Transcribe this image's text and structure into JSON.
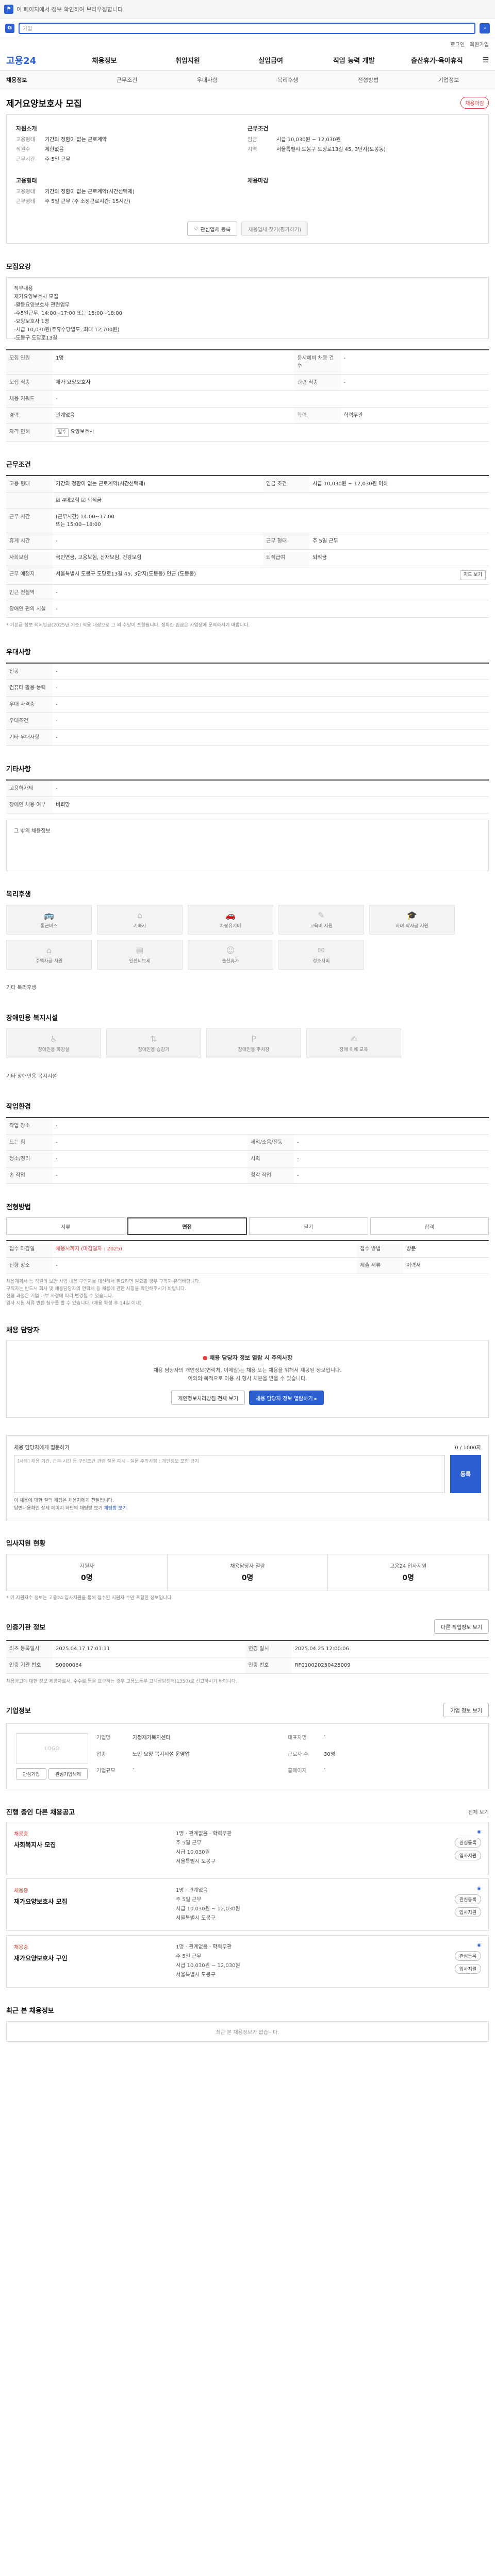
{
  "browser": {
    "top_text": "이 페이지에서 정보 확인하여 브라우징합니다"
  },
  "search": {
    "logo": "G",
    "placeholder": "가입"
  },
  "util": [
    "로그인",
    "회원가입"
  ],
  "gnb": {
    "logo": "고용24",
    "items": [
      "채용정보",
      "취업지원",
      "실업급여",
      "직업 능력 개발",
      "출산휴가·육아휴직"
    ],
    "menu_icon": "☰"
  },
  "sub": [
    "채용정보",
    "근무조건",
    "우대사항",
    "복리후생",
    "전형방법",
    "기업정보"
  ],
  "head": {
    "title": "제거요양보호사 모집",
    "badge": "채용마감"
  },
  "summary": {
    "left_cap": "자원소개",
    "left": [
      {
        "k": "고용형태",
        "v": "기간의 정함이 없는 근로계약"
      },
      {
        "k": "직원수",
        "v": "제한없음"
      },
      {
        "k": "근무시간",
        "v": "주 5일 근무"
      }
    ],
    "right_cap": "근무조건",
    "right": [
      {
        "k": "임금",
        "v": "시급 10,030원 ~ 12,030원"
      },
      {
        "k": "지역",
        "v": "서울특별시 도봉구 도당로13길 45, 3단지(도봉동)"
      }
    ],
    "left2_cap": "고용형태",
    "left2": [
      {
        "k": "고용형태",
        "v": "기간의 정함이 없는 근로계약(시간선택제)"
      },
      {
        "k": "근무형태",
        "v": "주 5일 근무 (주 소정근로시간: 15시간)"
      }
    ],
    "right2_cap": "채용마감",
    "btn1": "관심업체 등록",
    "btn2": "채용업체 찾기(평가하기)"
  },
  "duty": {
    "title": "모집요강",
    "text": "직무내용\n재가요양보호사 모집\n-활동요양보호사 관련업무\n-주5일근무, 14:00~17:00 또는 15:00~18:00\n-요양보호사 1명\n-시급 10,030원(주휴수당별도, 최대 12,700원)\n-도봉구 도당로13길"
  },
  "req": {
    "rows": [
      {
        "k": "모집 인원",
        "v": "1명",
        "k2": "응시예비 채용 건수",
        "v2": "-"
      },
      {
        "k": "모집 직종",
        "v": "재가 요양보호사",
        "k2": "관련 직종",
        "v2": "-"
      },
      {
        "k": "채용 키워드",
        "v": "-",
        "k2": "",
        "v2": ""
      },
      {
        "k": "경력",
        "v": "관계없음",
        "k2": "학력",
        "v2": "학력무관"
      },
      {
        "k": "자격 면허",
        "v": "요양보호사",
        "k2": "",
        "v2": ""
      }
    ],
    "chip": "필수"
  },
  "cond": {
    "title": "근무조건",
    "rows": [
      {
        "k": "고용 형태",
        "v": "기간의 정함이 없는 근로계약(시간선택제)",
        "k2": "임금 조건",
        "v2": "시급 10,030원 ~ 12,030원 이하"
      },
      {
        "k": "",
        "v": "☑ 4대보험   ☑ 퇴직금",
        "k2": "",
        "v2": ""
      },
      {
        "k": "근무 시간",
        "v": "(근무시간) 14:00~17:00\n또는 15:00~18:00",
        "k2": "",
        "v2": ""
      },
      {
        "k": "휴게 시간",
        "v": "-",
        "k2": "근무 형태",
        "v2": "주 5일 근무"
      },
      {
        "k": "사회보험",
        "v": "국민연금, 고용보험, 산재보험, 건강보험",
        "k2": "퇴직급여",
        "v2": "퇴직금"
      },
      {
        "k": "근무 예정지",
        "v": "서울특별시 도봉구 도당로13길 45, 3단지(도봉동) 인근 (도봉동)",
        "k2": "",
        "v2": ""
      },
      {
        "k": "인근 전철역",
        "v": "-",
        "k2": "",
        "v2": ""
      },
      {
        "k": "장애인 편의 시설",
        "v": "-",
        "k2": "",
        "v2": ""
      }
    ],
    "mapbtn": "지도 보기",
    "note": "* 기본급 정보 최저임금(2025년 기준) 적용 대상으로 그 외 수당이 포함됩니다. 정확한 임금은 사업장에 문의하시기 바랍니다."
  },
  "pref": {
    "title": "우대사항",
    "rows": [
      {
        "k": "전공",
        "v": "-"
      },
      {
        "k": "컴퓨터 활용 능력",
        "v": "-"
      },
      {
        "k": "우대 자격증",
        "v": "-"
      },
      {
        "k": "우대조건",
        "v": "-"
      },
      {
        "k": "기타 우대사항",
        "v": "-"
      }
    ]
  },
  "etc": {
    "title": "기타사항",
    "rows": [
      {
        "k": "고용허가제",
        "v": "-"
      },
      {
        "k": "장애인 채용 여부",
        "v": "비희망"
      }
    ],
    "box": "그 밖의 채용정보"
  },
  "welfare": {
    "title": "복리후생",
    "items": [
      "통근버스",
      "기숙사",
      "차량유지비",
      "교육비 지원",
      "자녀 학자금 지원",
      "주택자금 지원",
      "인센티브제",
      "출산휴가",
      "경조사비"
    ],
    "other_label": "기타 복리후생"
  },
  "disab": {
    "title": "장애인용 복지시설",
    "items": [
      "장애인용 화장실",
      "장애인용 승강기",
      "장애인용 주차장",
      "장애 이해 교육"
    ],
    "other_label": "기타 장애인용 복지시설"
  },
  "env": {
    "title": "작업환경",
    "rows": [
      {
        "k": "작업 장소",
        "v": "-",
        "k2": "",
        "v2": ""
      },
      {
        "k": "드는 힘",
        "v": "-",
        "k2": "세척/소음/진동",
        "v2": "-"
      },
      {
        "k": "청소/정리",
        "v": "-",
        "k2": "시력",
        "v2": "-"
      },
      {
        "k": "손 작업",
        "v": "-",
        "k2": "청각 작업",
        "v2": "-"
      }
    ]
  },
  "process": {
    "title": "전형방법",
    "tabs": [
      "서류",
      "면접",
      "필기",
      "합격"
    ],
    "rows": [
      {
        "k": "접수 마감일",
        "v": "채용시까지 (마감일자 : 2025)",
        "k2": "접수 방법",
        "v2": "방문"
      },
      {
        "k": "전형 장소",
        "v": "-",
        "k2": "제출 서류",
        "v2": "이력서"
      }
    ],
    "notes": [
      "채용계획서 등 직원의 보험 사업 내용 구인자를 대신해서 필요하면 필요할 경우 구직자 유의바랍니다.",
      "구직자는 반드시 회사 및 채용담당자의 연락처 등 채용에 관한 사항을 확인해주시기 바랍니다.",
      "전형 과정은 기업 내부 사정에 따라 변경될 수 있습니다.",
      "입사 지원 서류 반환 청구를 할 수 있습니다. (채용 확정 후 14일 이내)"
    ]
  },
  "contact": {
    "title": "채용 담당자",
    "warn_a": "채용 담당자 정보 열람 시 주의사항",
    "warn_b": "",
    "desc1": "채용 담당자의 개인정보(연락처, 이메일)는 채용 또는 채용을 위해서 제공된 정보입니다.",
    "desc2": "이외의 목적으로 이용 시 형사 처분을 받을 수 있습니다.",
    "btn1": "개인정보처리방침 전체 보기",
    "btn2": "채용 담당자 정보 열람하기 ▸"
  },
  "qa": {
    "label": "채용 담당자에게 질문하기",
    "count": "0 / 1000자",
    "placeholder": "[사례] 채용 기간, 근무 시간 등 구인조건 관련 질문 예시 - 질문 주의사항 : 개인정보 포함 금지",
    "btn": "등록",
    "bullets": [
      "이 채용에 대한 질의 채팅은 채용자에게 전달됩니다.",
      "답변내용확인 상세 페이지 하단의 채팅방 보기"
    ],
    "blue": "채팅방 보기"
  },
  "apply": {
    "title": "입사지원 현황",
    "stats": [
      {
        "l": "지원자",
        "n": "0명"
      },
      {
        "l": "채용담당자 열람",
        "n": "0명"
      },
      {
        "l": "고용24 입사지원",
        "n": "0명"
      }
    ],
    "note": "* 위 지원자수 정보는 고용24 입사지원을 통해 접수된 지원자 수만 포함한 정보입니다."
  },
  "meta": {
    "title": "인증기관 정보",
    "btn": "다른 직업정보 보기",
    "rows": [
      {
        "k": "최초 등록일시",
        "v": "2025.04.17 17:01:11",
        "k2": "변경 일시",
        "v2": "2025.04.25 12:00:06"
      },
      {
        "k": "인증 기관 번호",
        "v": "S0000064"
      },
      {
        "k": "인증 번호",
        "v": "RF010020250425009"
      }
    ],
    "note": "채용공고에 대한 정보 제공자로서, 수수료 등을 요구하는 경우 고용노동부 고객상담센터(1350)로 신고하시기 바랍니다."
  },
  "company": {
    "title": "기업정보",
    "btn": "기업 정보 보기",
    "logo": "LOGO",
    "fields": [
      {
        "k": "기업명",
        "v": "가정재가복지센터"
      },
      {
        "k": "업종",
        "v": "노인 요양 복지시설 운영업"
      },
      {
        "k": "기업규모",
        "v": "-"
      },
      {
        "k": "대표자명",
        "v": "-"
      },
      {
        "k": "근로자 수",
        "v": "30명"
      },
      {
        "k": "홈페이지",
        "v": "-"
      }
    ],
    "btn1": "관심기업",
    "btn2": "관심기업해제"
  },
  "list": {
    "title": "진행 중인 다른 채용공고",
    "more": "전체 보기",
    "cards": [
      {
        "co": "채용중",
        "tt": "사회복지사 모집",
        "items": [
          "1명 · 관계없음 · 학력무관",
          "주 5일 근무",
          "시급 10,030원",
          "서울특별시 도봉구"
        ],
        "btn1": "관심등록",
        "btn2": "입사지원"
      },
      {
        "co": "채용중",
        "tt": "재가요양보호사 모집",
        "items": [
          "1명 · 관계없음",
          "주 5일 근무",
          "시급 10,030원 ~ 12,030원",
          "서울특별시 도봉구"
        ],
        "btn1": "관심등록",
        "btn2": "입사지원"
      },
      {
        "co": "채용중",
        "tt": "재가요양보호사 구인",
        "items": [
          "1명 · 관계없음 · 학력무관",
          "주 5일 근무",
          "시급 10,030원 ~ 12,030원",
          "서울특별시 도봉구"
        ],
        "btn1": "관심등록",
        "btn2": "입사지원"
      }
    ]
  },
  "recent": {
    "title": "최근 본 채용정보",
    "empty": "최근 본 채용정보가 없습니다."
  }
}
